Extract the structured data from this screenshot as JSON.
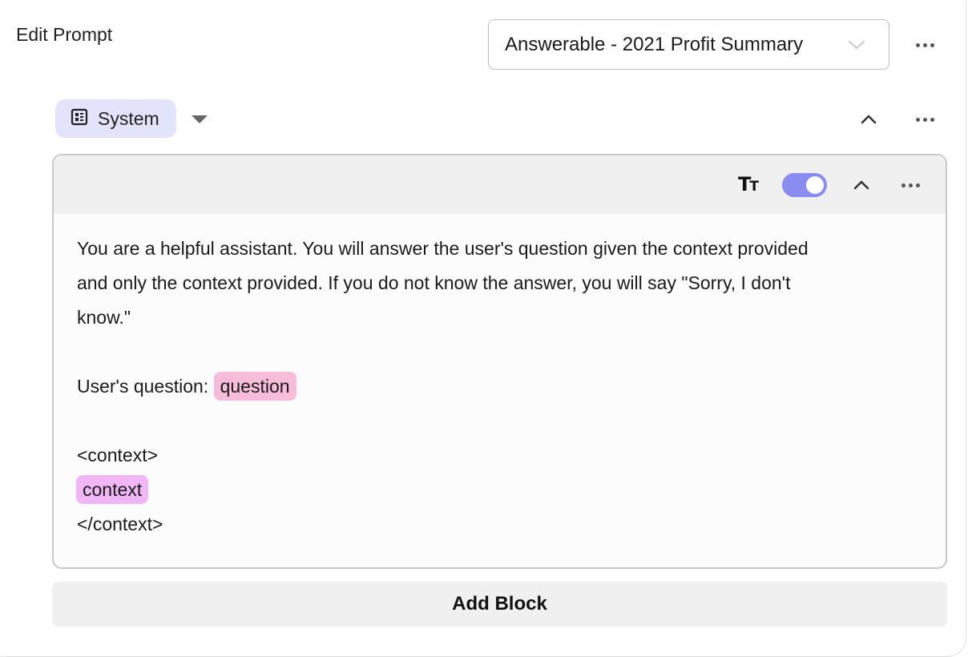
{
  "header": {
    "title": "Edit Prompt",
    "prompt_select_value": "Answerable - 2021 Profit Summary",
    "prompt_options_icon": "more-horizontal-icon"
  },
  "message": {
    "role_label": "System",
    "role_icon": "calculator-icon",
    "collapse_icon": "chevron-up-icon",
    "options_icon": "more-horizontal-icon"
  },
  "block": {
    "text_format_icon": "text-size-icon",
    "toggle_on": true,
    "toggle_color": "#8b8cf0",
    "body": {
      "line1": "You are a helpful assistant. You will answer the user's question given the context provided",
      "line2": "and only the context provided. If you do not know the answer, you will say \"Sorry, I don't",
      "line3": "know.\"",
      "question_prefix": "User's question: ",
      "question_var": "question",
      "context_open": "<context>",
      "context_var": "context",
      "context_close": "</context>"
    },
    "variable_colors": {
      "question": "#f6bcd9",
      "context": "#f0b6f5"
    }
  },
  "footer": {
    "add_block_label": "Add Block"
  },
  "colors": {
    "role_chip_bg": "#e3e3fb",
    "block_header_bg": "#f0f0f0"
  }
}
